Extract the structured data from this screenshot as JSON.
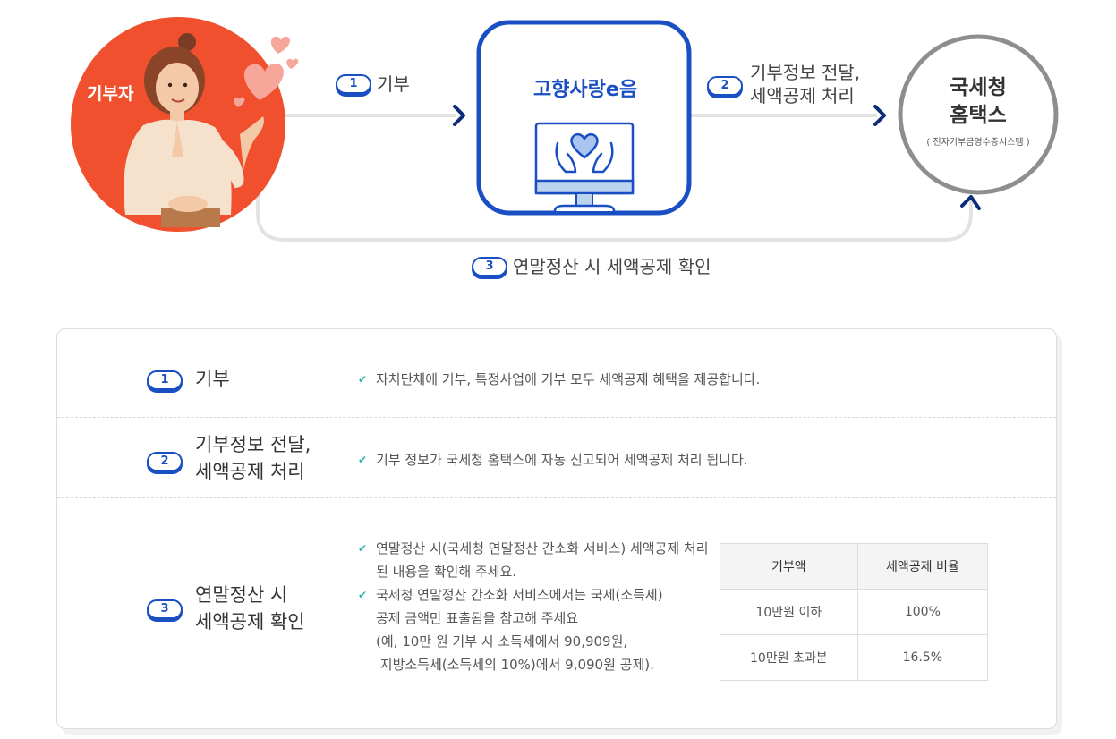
{
  "flow": {
    "donor_label": "기부자",
    "hub_title": "고향사랑e음",
    "nts_title_line1": "국세청",
    "nts_title_line2": "홈택스",
    "nts_subtitle": "( 전자기부금영수증시스템 )",
    "steps": [
      {
        "num": "1",
        "label": "기부"
      },
      {
        "num": "2",
        "label_line1": "기부정보 전달,",
        "label_line2": "세액공제 처리"
      },
      {
        "num": "3",
        "label": "연말정산 시 세액공제 확인"
      }
    ]
  },
  "details": {
    "rows": [
      {
        "num": "1",
        "title_line1": "기부",
        "bullets": [
          [
            "자치단체에 기부, 특정사업에 기부 모두 세액공제 혜택을 제공합니다."
          ]
        ]
      },
      {
        "num": "2",
        "title_line1": "기부정보 전달,",
        "title_line2": "세액공제 처리",
        "bullets": [
          [
            "기부 정보가 국세청 홈택스에 자동 신고되어 세액공제 처리 됩니다."
          ]
        ]
      },
      {
        "num": "3",
        "title_line1": "연말정산 시",
        "title_line2": "세액공제 확인",
        "bullets": [
          [
            "연말정산 시(국세청 연말정산 간소화 서비스) 세액공제 처리",
            "된 내용을 확인해 주세요."
          ],
          [
            "국세청 연말정산 간소화 서비스에서는 국세(소득세)",
            "공제 금액만 표출됨을 참고해 주세요",
            "(예, 10만 원 기부 시 소득세에서 90,909원,",
            " 지방소득세(소득세의 10%)에서 9,090원 공제)."
          ]
        ]
      }
    ],
    "table": {
      "headers": [
        "기부액",
        "세액공제 비율"
      ],
      "rows": [
        [
          "10만원 이하",
          "100%"
        ],
        [
          "10만원 초과분",
          "16.5%"
        ]
      ]
    }
  },
  "colors": {
    "accent": "#1a4fc4",
    "donor_circle": "#f0502e",
    "arrow": "#0d2d7a",
    "line": "#e3e3e3",
    "tick": "#2fb3b0"
  }
}
